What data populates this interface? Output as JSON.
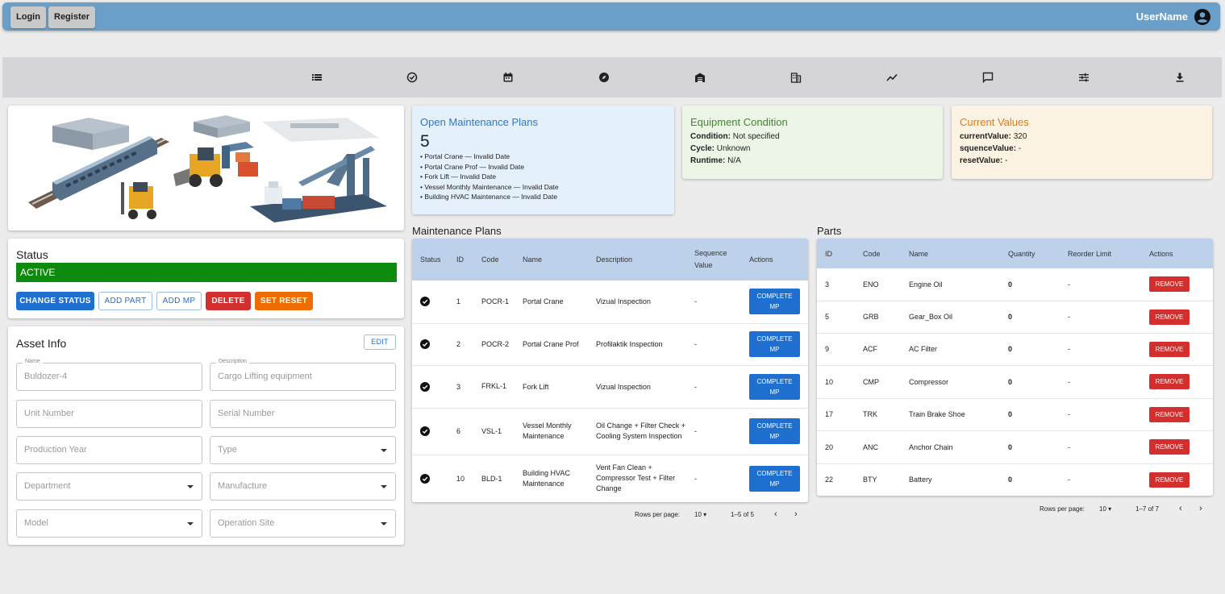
{
  "topbar": {
    "login": "Login",
    "register": "Register",
    "username": "UserName"
  },
  "nav": {
    "icons": [
      "list-icon",
      "check-circle-icon",
      "calendar-icon",
      "compass-icon",
      "warehouse-icon",
      "building-icon",
      "chart-line-icon",
      "chat-icon",
      "sliders-icon",
      "download-icon"
    ]
  },
  "status": {
    "title": "Status",
    "value": "ACTIVE",
    "color": "#0e8a0e",
    "buttons": {
      "change_status": "CHANGE STATUS",
      "add_part": "ADD PART",
      "add_mp": "ADD MP",
      "delete": "DELETE",
      "set_reset": "SET RESET"
    }
  },
  "asset_info": {
    "title": "Asset Info",
    "edit": "EDIT",
    "fields": {
      "name_label": "Name",
      "name_value": "Buldozer-4",
      "description_label": "Description",
      "description_value": "Cargo Lifting equipment",
      "unit_number": "Unit Number",
      "serial_number": "Serial Number",
      "production_year": "Production Year",
      "type": "Type",
      "department": "Department",
      "manufacture": "Manufacture",
      "model": "Model",
      "operation_site": "Operation Site"
    }
  },
  "open_plans": {
    "title": "Open Maintenance Plans",
    "count": "5",
    "items": [
      "• Portal Crane — Invalid Date",
      "• Portal Crane Prof — Invalid Date",
      "• Fork Lift — Invalid Date",
      "• Vessel Monthly Maintenance — Invalid Date",
      "• Building HVAC Maintenance — Invalid Date"
    ]
  },
  "equipment_condition": {
    "title": "Equipment Condition",
    "condition_label": "Condition:",
    "condition_value": " Not specified",
    "cycle_label": "Cycle:",
    "cycle_value": " Unknown",
    "runtime_label": "Runtime:",
    "runtime_value": " N/A"
  },
  "current_values": {
    "title": "Current Values",
    "current_label": "currentValue:",
    "current_value": " 320",
    "sequence_label": "squenceValue:",
    "sequence_value": " -",
    "reset_label": "resetValue:",
    "reset_value": " -"
  },
  "maintenance_plans": {
    "title": "Maintenance Plans",
    "headers": {
      "status": "Status",
      "id": "ID",
      "code": "Code",
      "name": "Name",
      "description": "Description",
      "sequence": "Sequence Value",
      "actions": "Actions"
    },
    "action_label": "COMPLETE MP",
    "rows": [
      {
        "id": "1",
        "code": "POCR-1",
        "name": "Portal Crane",
        "description": "Vizual Inspection",
        "sequence": "-"
      },
      {
        "id": "2",
        "code": "POCR-2",
        "name": "Portal Crane Prof",
        "description": "Profilaktik Inspection",
        "sequence": "-"
      },
      {
        "id": "3",
        "code": "FRKL-1",
        "name": "Fork Lift",
        "description": "Vizual Inspection",
        "sequence": "-"
      },
      {
        "id": "6",
        "code": "VSL-1",
        "name": "Vessel Monthly Maintenance",
        "description": "Oil Change + Filter Check + Cooling System Inspection",
        "sequence": "-"
      },
      {
        "id": "10",
        "code": "BLD-1",
        "name": "Building HVAC Maintenance",
        "description": "Vent Fan Clean + Compressor Test + Filter Change",
        "sequence": "-"
      }
    ],
    "pager": {
      "rows_label": "Rows per page:",
      "rows_value": "10",
      "range": "1–5 of 5"
    }
  },
  "parts": {
    "title": "Parts",
    "headers": {
      "id": "ID",
      "code": "Code",
      "name": "Name",
      "quantity": "Quantity",
      "reorder": "Reorder Limit",
      "actions": "Actions"
    },
    "action_label": "REMOVE",
    "rows": [
      {
        "id": "3",
        "code": "ENO",
        "name": "Engine Oil",
        "quantity": "0",
        "reorder": "-"
      },
      {
        "id": "5",
        "code": "GRB",
        "name": "Gear_Box Oil",
        "quantity": "0",
        "reorder": "-"
      },
      {
        "id": "9",
        "code": "ACF",
        "name": "AC Filter",
        "quantity": "0",
        "reorder": "-"
      },
      {
        "id": "10",
        "code": "CMP",
        "name": "Compressor",
        "quantity": "0",
        "reorder": "-"
      },
      {
        "id": "17",
        "code": "TRK",
        "name": "Train Brake Shoe",
        "quantity": "0",
        "reorder": "-"
      },
      {
        "id": "20",
        "code": "ANC",
        "name": "Anchor Chain",
        "quantity": "0",
        "reorder": "-"
      },
      {
        "id": "22",
        "code": "BTY",
        "name": "Battery",
        "quantity": "0",
        "reorder": "-"
      }
    ],
    "pager": {
      "rows_label": "Rows per page:",
      "rows_value": "10",
      "range": "1–7 of 7"
    }
  }
}
